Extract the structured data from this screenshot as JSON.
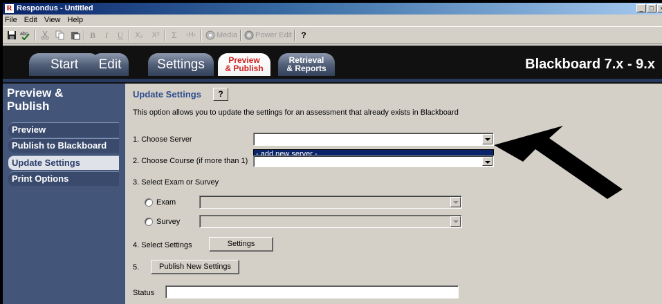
{
  "window": {
    "title": "Respondus - Untitled",
    "icon_letter": "R",
    "controls": [
      "_",
      "□",
      "×"
    ]
  },
  "menu": [
    "File",
    "Edit",
    "View",
    "Help"
  ],
  "toolbar": {
    "icons": [
      "save-icon",
      "spellcheck-icon",
      "cut-icon",
      "copy-icon",
      "paste-icon",
      "bold-icon",
      "italic-icon",
      "underline-icon",
      "subscript-icon",
      "superscript-icon",
      "equation-icon",
      "html-icon",
      "media-icon",
      "power-edit-icon",
      "help-icon"
    ],
    "glyphs": {
      "bold": "B",
      "italic": "I",
      "underline": "U",
      "subscript": "X₂",
      "superscript": "X²",
      "equation": "Σ",
      "html": "‹H›",
      "help": "?"
    },
    "media_label": "Media",
    "power_edit_label": "Power Edit"
  },
  "tabs": [
    {
      "label": "Start"
    },
    {
      "label": "Edit"
    },
    {
      "label": "Settings"
    },
    {
      "line1": "Preview",
      "line2": "& Publish",
      "active": true
    },
    {
      "line1": "Retrieval",
      "line2": "& Reports"
    }
  ],
  "product": "Blackboard 7.x - 9.x",
  "sidebar": {
    "heading_line1": "Preview &",
    "heading_line2": "Publish",
    "items": [
      {
        "label": "Preview"
      },
      {
        "label": "Publish to Blackboard"
      },
      {
        "label": "Update Settings",
        "active": true
      },
      {
        "label": "Print Options"
      }
    ]
  },
  "main": {
    "heading": "Update Settings",
    "help_label": "?",
    "description": "This option allows you to update the settings for an assessment that already exists in Blackboard",
    "step1": "1.  Choose Server",
    "dropdown_option": "- add new server -",
    "step2": "2.  Choose Course (if more than 1)",
    "step3": "3.  Select Exam or Survey",
    "exam_label": "Exam",
    "survey_label": "Survey",
    "step4": "4.  Select Settings",
    "settings_button": "Settings",
    "step5": "5.",
    "publish_button": "Publish New Settings",
    "status_label": "Status",
    "status_value": ""
  },
  "colors": {
    "accent": "#2e4d8c",
    "active_tab_text": "#d02020",
    "sidebar": "#44557a",
    "selection": "#0a246a"
  }
}
